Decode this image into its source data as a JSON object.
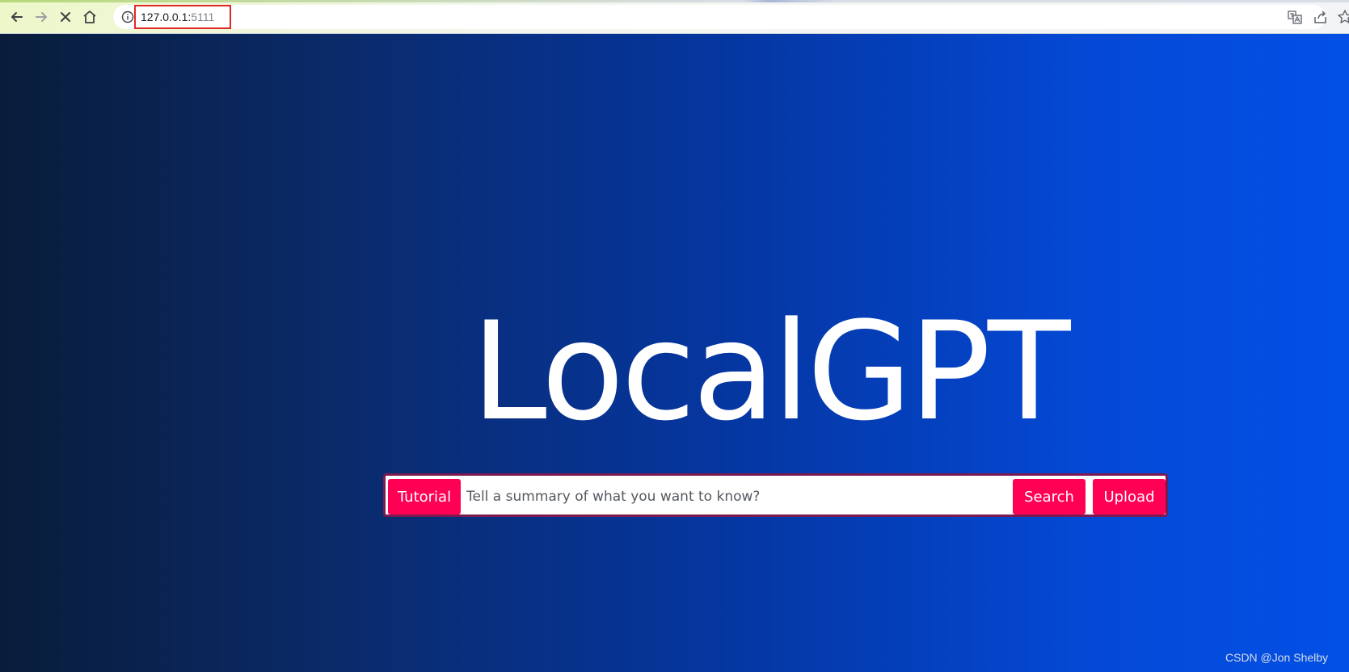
{
  "browser": {
    "url_host": "127.0.0.1:",
    "url_port": "5111",
    "icons": [
      "back-arrow-icon",
      "forward-arrow-icon",
      "stop-loading-icon",
      "home-icon",
      "info-icon",
      "translate-icon",
      "share-icon",
      "bookmark-star-icon"
    ]
  },
  "hero": {
    "title": "LocalGPT"
  },
  "search": {
    "tutorial_label": "Tutorial",
    "placeholder": "Tell a summary of what you want to know?",
    "search_label": "Search",
    "upload_label": "Upload"
  },
  "watermark": {
    "text": "CSDN @Jon Shelby"
  },
  "colors": {
    "button": "#ff0055",
    "panel_border": "#7a1a50",
    "gradient_left": "#091d3a",
    "gradient_right": "#0350e6",
    "url_highlight_border": "#e02828"
  }
}
